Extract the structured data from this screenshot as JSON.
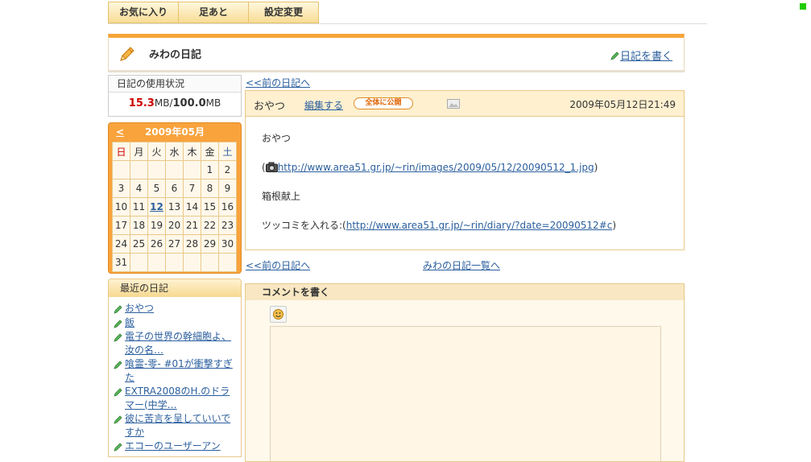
{
  "top_tabs": [
    "お気に入り",
    "足あと",
    "設定変更"
  ],
  "header": {
    "title": "みわの日記",
    "write_link": "日記を書く"
  },
  "usage": {
    "heading": "日記の使用状況",
    "used": "15.3",
    "used_unit": "MB/",
    "total": "100.0",
    "total_unit": "MB"
  },
  "calendar": {
    "prev": "<",
    "month_label": "2009年05月",
    "weekdays": [
      "日",
      "月",
      "火",
      "水",
      "木",
      "金",
      "土"
    ],
    "weeks": [
      [
        "",
        "",
        "",
        "",
        "",
        "1",
        "2"
      ],
      [
        "3",
        "4",
        "5",
        "6",
        "7",
        "8",
        "9"
      ],
      [
        "10",
        "11",
        "12",
        "13",
        "14",
        "15",
        "16"
      ],
      [
        "17",
        "18",
        "19",
        "20",
        "21",
        "22",
        "23"
      ],
      [
        "24",
        "25",
        "26",
        "27",
        "28",
        "29",
        "30"
      ],
      [
        "31",
        "",
        "",
        "",
        "",
        "",
        ""
      ]
    ],
    "linked_day": "12"
  },
  "recent": {
    "heading": "最近の日記",
    "items": [
      "おやつ",
      "飯",
      "電子の世界の幹細胞よ、汝の名…",
      "喰霊-零- #01が衝撃すぎた",
      "EXTRA2008のH.のドラマー(中学…",
      "彼に苦言を呈していいですか",
      "エコーのユーザーアン"
    ]
  },
  "nav": {
    "prev_top": "<<前の日記へ",
    "prev_bottom": "<<前の日記へ",
    "list": "みわの日記一覧へ"
  },
  "entry": {
    "title": "おやつ",
    "edit": "編集する",
    "visibility": "全体に公開",
    "date": "2009年05月12日21:49",
    "line1": "おやつ",
    "image_link": "http://www.area51.gr.jp/~rin/images/2009/05/12/20090512_1.jpg",
    "line3": "箱根献上",
    "tsukkomi_label": "ツッコミを入れる:(",
    "tsukkomi_link": "http://www.area51.gr.jp/~rin/diary/?date=20090512#c",
    "tsukkomi_close": ")",
    "open_paren": "(",
    "close_paren": ")"
  },
  "comment": {
    "heading": "コメントを書く"
  },
  "colors": {
    "accent": "#f9a33d",
    "link": "#2b5f9e",
    "used": "#cc0000"
  }
}
